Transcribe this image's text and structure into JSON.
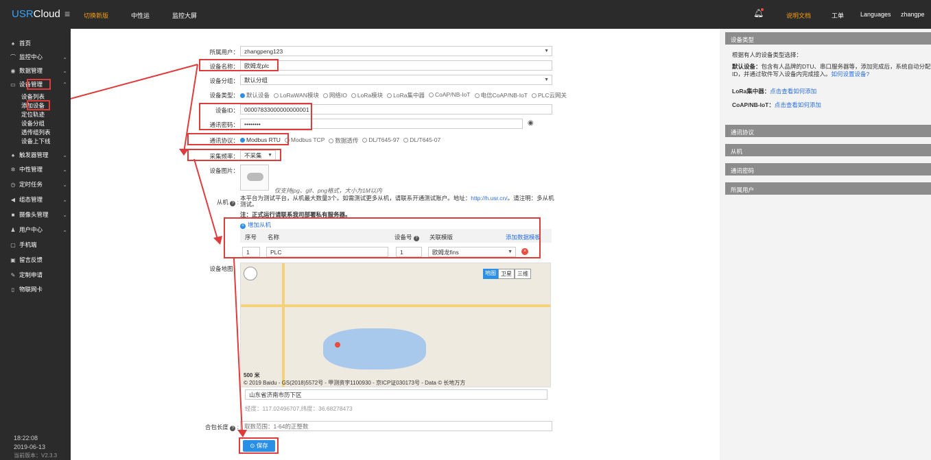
{
  "topbar": {
    "logo_usr": "USR",
    "logo_cloud": "Cloud",
    "switch_new": "切换新版",
    "middleware": "中性运",
    "monitor_screen": "监控大屏",
    "docs": "说明文档",
    "ticket": "工单",
    "languages": "Languages",
    "user": "zhangpe"
  },
  "sidebar": {
    "items": [
      {
        "icon": "home-icon",
        "glyph": "♠",
        "label": "首页"
      },
      {
        "icon": "monitor-icon",
        "glyph": "⌒",
        "label": "监控中心"
      },
      {
        "icon": "data-icon",
        "glyph": "◉",
        "label": "数据管理"
      },
      {
        "icon": "device-icon",
        "glyph": "▭",
        "label": "设备管理"
      },
      {
        "icon": "trigger-icon",
        "glyph": "♠",
        "label": "触发器管理"
      },
      {
        "icon": "middleware-icon",
        "glyph": "✲",
        "label": "中性管理"
      },
      {
        "icon": "timer-icon",
        "glyph": "◷",
        "label": "定时任务"
      },
      {
        "icon": "config-icon",
        "glyph": "◀",
        "label": "组态管理"
      },
      {
        "icon": "camera-icon",
        "glyph": "■",
        "label": "摄像头管理"
      },
      {
        "icon": "user-center-icon",
        "glyph": "♟",
        "label": "用户中心"
      },
      {
        "icon": "mobile-icon",
        "glyph": "▢",
        "label": "手机端"
      },
      {
        "icon": "feedback-icon",
        "glyph": "▣",
        "label": "留言反馈"
      },
      {
        "icon": "custom-icon",
        "glyph": "✎",
        "label": "定制申请"
      },
      {
        "icon": "iot-card-icon",
        "glyph": "▯",
        "label": "物联网卡"
      }
    ],
    "sub_items": [
      "设备列表",
      "添加设备",
      "定位轨迹",
      "设备分组",
      "透传组列表",
      "设备上下线"
    ],
    "time": "18:22:08",
    "date": "2019-06-13",
    "version": "当前版本：V2.3.3"
  },
  "form": {
    "owner_label": "所属用户：",
    "owner_value": "zhangpeng123",
    "name_label": "设备名称：",
    "name_value": "欧姆龙plc",
    "group_label": "设备分组：",
    "group_value": "默认分组",
    "type_label": "设备类型：",
    "type_options": [
      "默认设备",
      "LoRaWAN模块",
      "网络IO",
      "LoRa模块",
      "LoRa集中器",
      "CoAP/NB-IoT",
      "电信CoAP/NB-IoT",
      "PLC云网关"
    ],
    "id_label": "设备ID：",
    "id_value": "00007833000000000001",
    "pwd_label": "通讯密码：",
    "pwd_value": "••••••••",
    "protocol_label": "通讯协议：",
    "protocol_options": [
      "Modbus RTU",
      "Modbus TCP",
      "数据透传",
      "DL/T645-97",
      "DL/T645-07"
    ],
    "freq_label": "采集频率：",
    "freq_value": "不采集",
    "image_label": "设备图片：",
    "image_hint": "仅支持jpg、gif、png格式，大小为1M以内",
    "slave_label": "从机",
    "slave_note1": "本平台为测试平台，从机最大数量3个。如需测试更多从机，请联系开通测试账户。地址：",
    "slave_note_link": "http://h.usr.cn/",
    "slave_note2": "。请注明：多从机测试。",
    "slave_note3": "注：正式运行请联系我司部署私有服务器。",
    "add_slave": "增加从机",
    "slave_cols": [
      "序号",
      "名称",
      "设备号",
      "关联模版",
      "添加数据模板"
    ],
    "slave_row": {
      "index": "1",
      "name": "PLC",
      "device_no": "1",
      "template": "欧姆龙fins"
    },
    "map_label": "设备地图：",
    "map_copyright": "© 2019 Baidu - GS(2018)5572号 - 甲测资字1100930 - 京ICP证030173号 - Data © 长地万方",
    "map_scale": "500 米",
    "map_view_map": "地图",
    "map_view_sat": "卫星",
    "map_view_3d": "三维",
    "address_value": "山东省济南市历下区",
    "coords": "经度：117.02496707,纬度：36.68278473",
    "packet_label": "合包长度",
    "packet_placeholder": "取数范围：1-64的正整数",
    "save": "保存"
  },
  "right_panel": {
    "device_type_head": "设备类型",
    "intro": "根据有人的设备类型选择：",
    "default_title": "默认设备：",
    "default_desc": "包含有人品牌的DTU、串口服务器等，添加完成后，系统自动分配ID，并通过软件写入设备内完成接入。",
    "default_link": "如何设置设备?",
    "lora_title": "LoRa集中器：",
    "lora_link": "点击查看如何添加",
    "coap_title": "CoAP/NB-IoT：",
    "coap_link": "点击查看如何添加",
    "sections": [
      "通讯协议",
      "从机",
      "通讯密码",
      "所属用户"
    ]
  },
  "colors": {
    "accent": "#2b8fe6",
    "annotation": "#e03b3b",
    "topbar": "#2b2b2b"
  }
}
